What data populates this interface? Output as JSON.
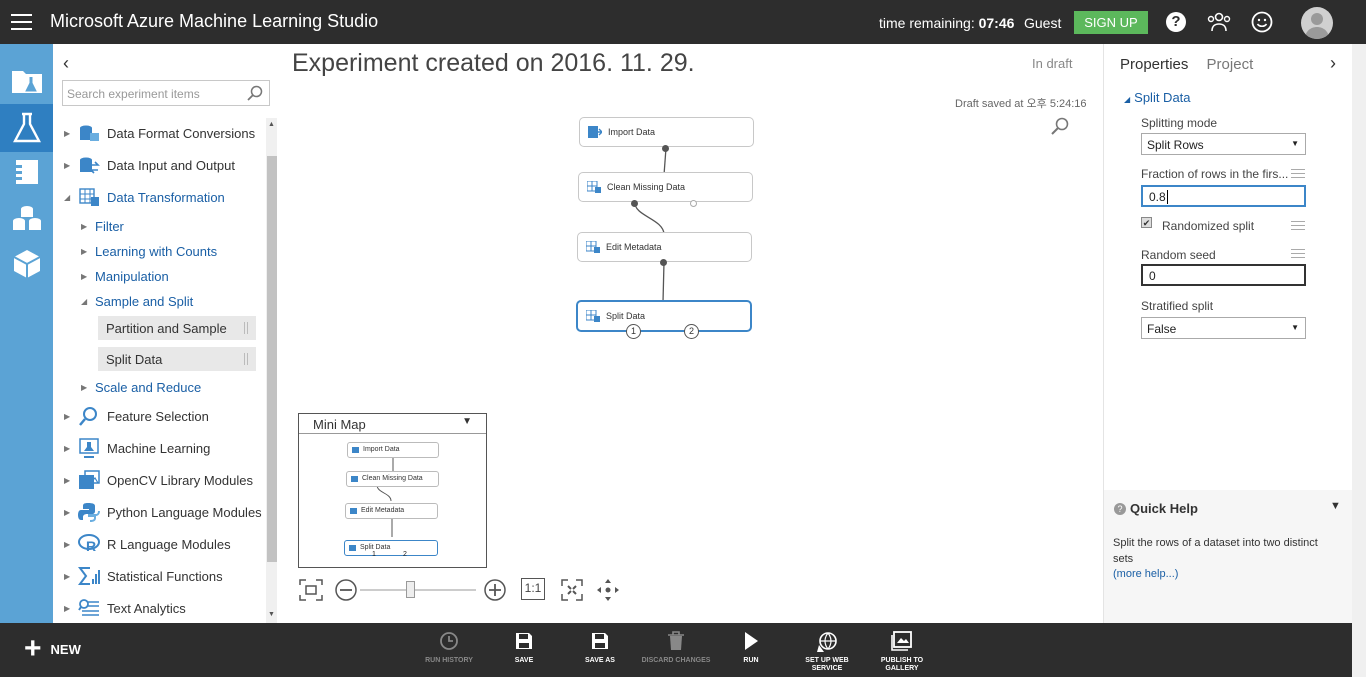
{
  "header": {
    "title": "Microsoft Azure Machine Learning Studio",
    "time_remaining_label": "time remaining:",
    "time_remaining_value": "07:46",
    "user": "Guest",
    "signup_label": "SIGN UP",
    "help_glyph": "?",
    "accent": "#5cb85c"
  },
  "palette": {
    "collapse_glyph": "‹",
    "search_placeholder": "Search experiment items",
    "categories": [
      {
        "label": "Data Format Conversions"
      },
      {
        "label": "Data Input and Output"
      },
      {
        "label": "Data Transformation"
      },
      {
        "label": "Filter"
      },
      {
        "label": "Learning with Counts"
      },
      {
        "label": "Manipulation"
      },
      {
        "label": "Sample and Split"
      },
      {
        "label": "Partition and Sample"
      },
      {
        "label": "Split Data"
      },
      {
        "label": "Scale and Reduce"
      },
      {
        "label": "Feature Selection"
      },
      {
        "label": "Machine Learning"
      },
      {
        "label": "OpenCV Library Modules"
      },
      {
        "label": "Python Language Modules"
      },
      {
        "label": "R Language Modules"
      },
      {
        "label": "Statistical Functions"
      },
      {
        "label": "Text Analytics"
      }
    ]
  },
  "canvas": {
    "title": "Experiment created on 2016. 11. 29.",
    "status": "In draft",
    "saved_at": "Draft saved at 오후 5:24:16",
    "modules": [
      "Import Data",
      "Clean Missing Data",
      "Edit Metadata",
      "Split Data"
    ],
    "ports": [
      "1",
      "2"
    ]
  },
  "minimap": {
    "title": "Mini Map",
    "modules": [
      "Import Data",
      "Clean Missing Data",
      "Edit Metadata",
      "Split Data"
    ],
    "ports": [
      "1",
      "2"
    ]
  },
  "zoom": {
    "actual_size_label": "1:1"
  },
  "properties": {
    "tab_properties": "Properties",
    "tab_project": "Project",
    "section": "Split Data",
    "splitting_mode_label": "Splitting mode",
    "splitting_mode_value": "Split Rows",
    "fraction_label": "Fraction of rows in the firs...",
    "fraction_value": "0.8",
    "randomized_label": "Randomized split",
    "randomized_checked": true,
    "seed_label": "Random seed",
    "seed_value": "0",
    "stratified_label": "Stratified split",
    "stratified_value": "False"
  },
  "quick_help": {
    "title": "Quick Help",
    "text": "Split the rows of a dataset into two distinct sets",
    "link": "(more help...)"
  },
  "bottombar": {
    "new_label": "NEW",
    "commands": [
      {
        "label": "RUN HISTORY",
        "enabled": false
      },
      {
        "label": "SAVE",
        "enabled": true
      },
      {
        "label": "SAVE AS",
        "enabled": true
      },
      {
        "label": "DISCARD CHANGES",
        "enabled": false
      },
      {
        "label": "RUN",
        "enabled": true
      },
      {
        "label": "SET UP WEB SERVICE",
        "enabled": true
      },
      {
        "label": "PUBLISH TO GALLERY",
        "enabled": true
      }
    ]
  }
}
